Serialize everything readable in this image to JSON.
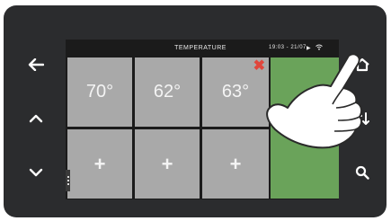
{
  "screen": {
    "title": "TEMPERATURE",
    "clock": "19:03 - 21/07",
    "play_glyph": "▶",
    "wifi_icon": "wifi-icon"
  },
  "tiles": [
    {
      "label": "70°"
    },
    {
      "label": "62°"
    },
    {
      "label": "63°",
      "remove_glyph": "✖"
    }
  ],
  "add_tiles": [
    {
      "label": "+"
    },
    {
      "label": "+"
    },
    {
      "label": "+"
    }
  ],
  "side_buttons": {
    "left": [
      "back-arrow-icon",
      "chevron-up-icon",
      "chevron-down-icon"
    ],
    "right": [
      "home-icon",
      "swap-arrows-icon",
      "search-icon"
    ]
  },
  "colors": {
    "bezel": "#2b2c2e",
    "tile": "#a9a9a9",
    "active_panel": "#6aa35a",
    "remove": "#e0463c"
  }
}
